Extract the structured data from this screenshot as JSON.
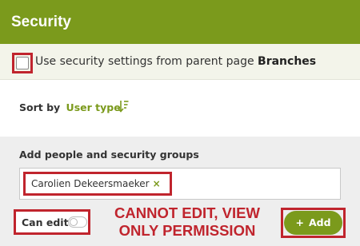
{
  "header": {
    "title": "Security"
  },
  "inherit": {
    "checked": false,
    "text": "Use security settings from parent page",
    "parent_page": "Branches"
  },
  "sort": {
    "label": "Sort by",
    "value": "User type",
    "icon": "sort-descending-icon"
  },
  "people": {
    "label": "Add people and security groups",
    "chips": [
      {
        "name": "Carolien Dekeersmaeker",
        "remove_glyph": "×"
      }
    ]
  },
  "permission": {
    "label": "Can edit",
    "enabled": false
  },
  "annotation": {
    "line1": "CANNOT EDIT, VIEW",
    "line2": "ONLY PERMISSION"
  },
  "add_button": {
    "glyph": "+",
    "label": "Add"
  },
  "colors": {
    "accent": "#7b9a1c",
    "highlight": "#c0242d"
  }
}
